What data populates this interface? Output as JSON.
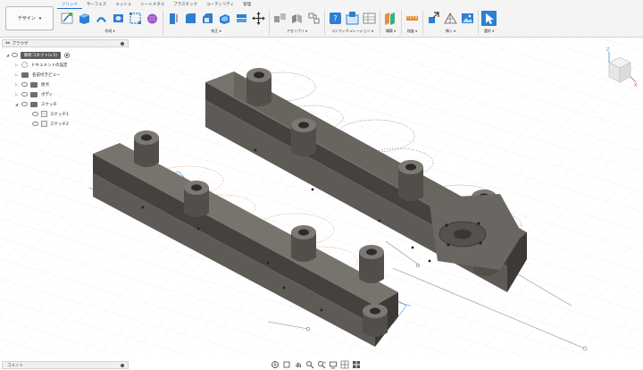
{
  "toolbar": {
    "workspace_label": "デザイン",
    "tabs": [
      "ソリッド",
      "サーフェス",
      "メッシュ",
      "シートメタル",
      "プラスチック",
      "ユーティリティ",
      "管理"
    ],
    "groups": {
      "create": "作成",
      "modify": "修正",
      "assemble": "アセンブリ",
      "configure": "コンフィギュレーション",
      "construct": "構築",
      "inspect": "検査",
      "insert": "挿入",
      "select": "選択"
    }
  },
  "browser": {
    "title": "ブラウザ",
    "items": [
      {
        "label": "解析コネクト(v.5)"
      },
      {
        "label": "ドキュメントの設定"
      },
      {
        "label": "名前付きビュー"
      },
      {
        "label": "原点"
      },
      {
        "label": "ボディ"
      },
      {
        "label": "スケッチ"
      },
      {
        "label": "スケッチ1"
      },
      {
        "label": "スケッチ2"
      }
    ]
  },
  "viewcube": {
    "z_label": "Z",
    "x_label": "X"
  },
  "comment": {
    "label": "コメント"
  },
  "colors": {
    "accent": "#1a6fd1",
    "body": "#5e5a56",
    "body_top": "#77736d",
    "body_side": "#45413e",
    "sketch_orange": "#e07a3a",
    "sketch_blue": "#4a8fd6"
  }
}
